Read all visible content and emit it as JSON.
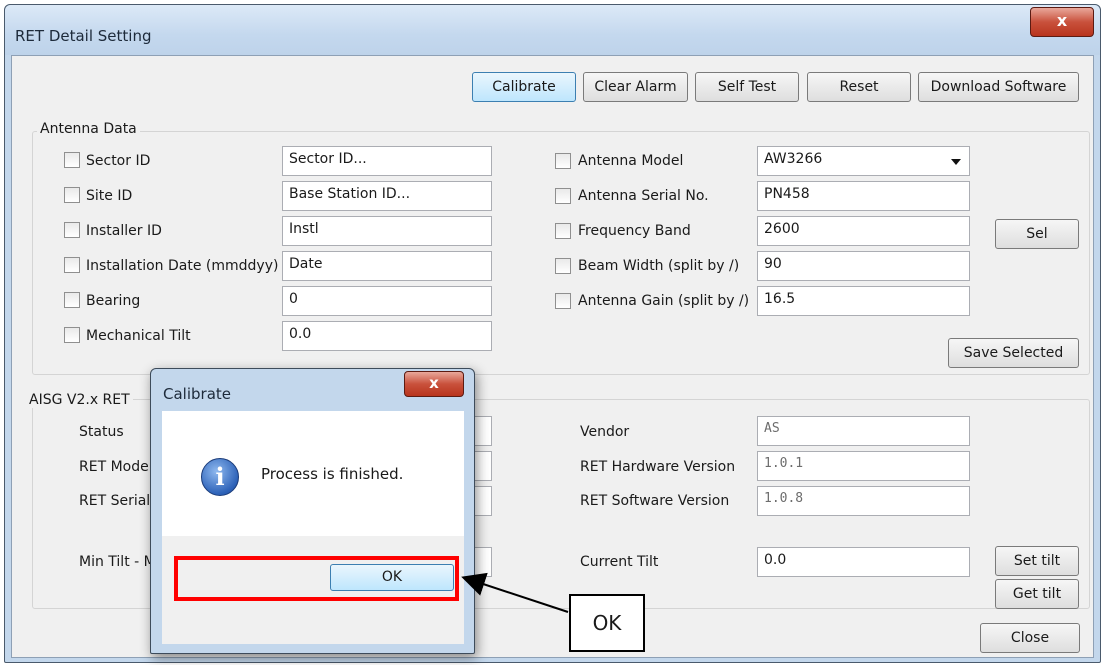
{
  "window": {
    "title": "RET Detail Setting",
    "close_glyph": "x"
  },
  "toolbar": {
    "calibrate": "Calibrate",
    "clear_alarm": "Clear Alarm",
    "self_test": "Self Test",
    "reset": "Reset",
    "download_software": "Download Software"
  },
  "antenna_data": {
    "title": "Antenna Data",
    "left_fields": [
      {
        "label": "Sector ID",
        "value": "Sector ID..."
      },
      {
        "label": "Site ID",
        "value": "Base Station ID..."
      },
      {
        "label": "Installer ID",
        "value": "Instl"
      },
      {
        "label": "Installation Date (mmddyy)",
        "value": "Date"
      },
      {
        "label": "Bearing",
        "value": "0"
      },
      {
        "label": "Mechanical Tilt",
        "value": "0.0"
      }
    ],
    "right_fields": [
      {
        "label": "Antenna Model",
        "value": "AW3266"
      },
      {
        "label": "Antenna Serial No.",
        "value": "PN458"
      },
      {
        "label": "Frequency Band",
        "value": "2600"
      },
      {
        "label": "Beam Width (split by /)",
        "value": "90"
      },
      {
        "label": "Antenna Gain (split by /)",
        "value": "16.5"
      }
    ],
    "sel_button": "Sel",
    "save_selected_button": "Save Selected"
  },
  "ret_section": {
    "title": "AISG V2.x RET",
    "left_labels": [
      "Status",
      "RET Mode",
      "RET Serial",
      "Min Tilt - M"
    ],
    "right_fields": [
      {
        "label": "Vendor",
        "value": "AS"
      },
      {
        "label": "RET Hardware Version",
        "value": "1.0.1"
      },
      {
        "label": "RET Software Version",
        "value": "1.0.8"
      },
      {
        "label": "Current Tilt",
        "value": "0.0"
      }
    ],
    "set_tilt_button": "Set tilt",
    "get_tilt_button": "Get tilt"
  },
  "close_button": "Close",
  "dialog": {
    "title": "Calibrate",
    "message": "Process is finished.",
    "ok_button": "OK",
    "icon": "info-icon",
    "close_glyph": "x"
  },
  "annotation": {
    "callout_text": "OK",
    "highlight_color": "#ff0000"
  }
}
